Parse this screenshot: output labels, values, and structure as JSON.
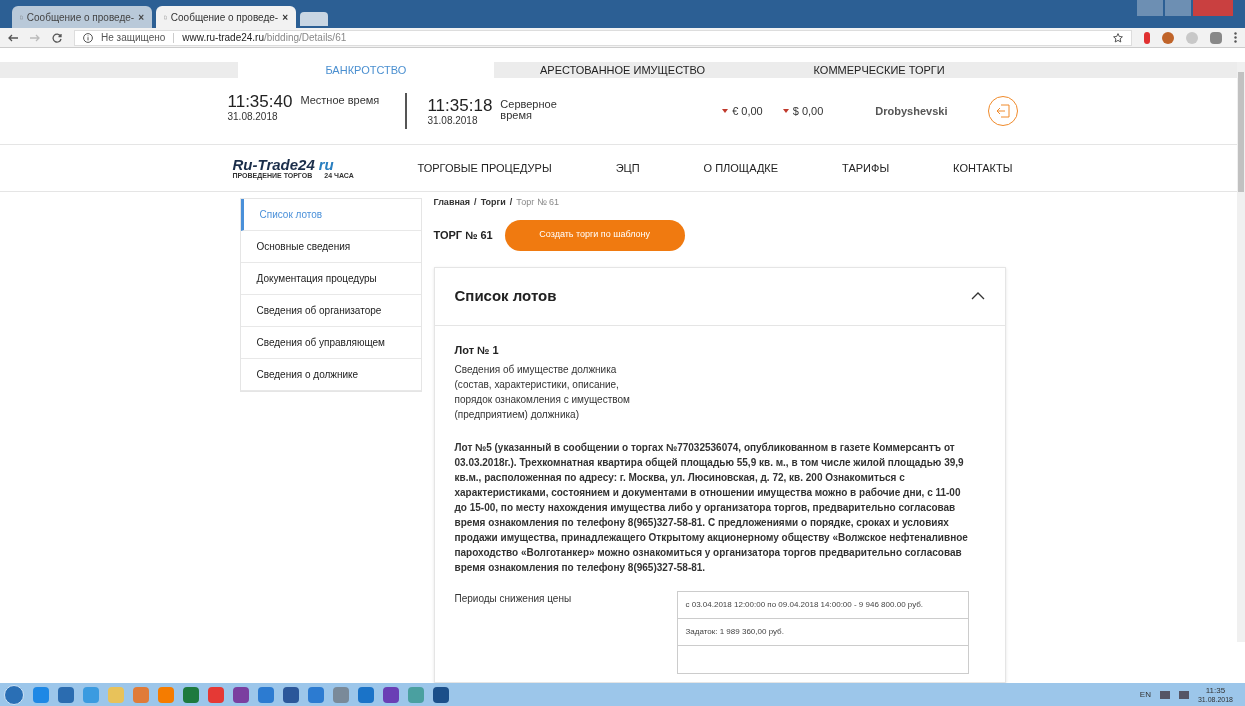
{
  "browser": {
    "tabs": [
      {
        "title": "Сообщение о проведе-",
        "close": "×",
        "selected": false
      },
      {
        "title": "Сообщение о проведе-",
        "close": "×",
        "selected": true
      }
    ],
    "security": "Не защищено",
    "url_host": "www.ru-trade24.ru",
    "url_path": "/bidding/Details/61"
  },
  "site_tabs": [
    {
      "label": "БАНКРОТСТВО",
      "selected": true
    },
    {
      "label": "АРЕСТОВАННОЕ ИМУЩЕСТВО",
      "selected": false
    },
    {
      "label": "КОММЕРЧЕСКИЕ ТОРГИ",
      "selected": false
    }
  ],
  "clocks": [
    {
      "time": "11:35:40",
      "date": "31.08.2018",
      "label": "Местное время"
    },
    {
      "time": "11:35:18",
      "date": "31.08.2018",
      "label": "Серверное время"
    }
  ],
  "balances": [
    "€ 0,00",
    "$ 0,00"
  ],
  "user": "Drobyshevski",
  "logo": {
    "main": "Ru-Trade24",
    "suffix": "ru",
    "tagline": "ПРОВЕДЕНИЕ ТОРГОВ",
    "hours": "24 ЧАСА"
  },
  "nav": [
    "ТОРГОВЫЕ ПРОЦЕДУРЫ",
    "ЭЦП",
    "О ПЛОЩАДКЕ",
    "ТАРИФЫ",
    "КОНТАКТЫ"
  ],
  "sidebar": [
    {
      "label": "Список лотов",
      "selected": true
    },
    {
      "label": "Основные сведения",
      "selected": false
    },
    {
      "label": "Документация процедуры",
      "selected": false
    },
    {
      "label": "Сведения об организаторе",
      "selected": false
    },
    {
      "label": "Сведения об управляющем",
      "selected": false
    },
    {
      "label": "Сведения о должнике",
      "selected": false
    }
  ],
  "breadcrumbs": [
    {
      "label": "Главная",
      "current": false
    },
    {
      "label": "Торги",
      "current": false
    },
    {
      "label": "Торг № 61",
      "current": true
    }
  ],
  "breadcrumb_separator": "/",
  "title": "ТОРГ № 61",
  "create_button": "Создать торги по шаблону",
  "panel": {
    "title": "Список лотов",
    "expanded": true,
    "lot_title": "Лот № 1",
    "property_label": "Сведения об имуществе должника (состав, характеристики, описание, порядок ознакомления с имуществом (предприятием) должника)",
    "property_text": "Лот №5 (указанный в сообщении о торгах №77032536074, опубликованном в газете Коммерсантъ от 03.03.2018г.). Трехкомнатная квартира общей площадью 55,9 кв. м., в том числе жилой площадью 39,9 кв.м., расположенная по адресу: г. Москва, ул. Люсиновская, д. 72, кв. 200 Ознакомиться с характеристиками, состоянием и документами в отношении имущества можно в рабочие дни, с 11-00 до 15-00, по месту нахождения имущества либо у организатора торгов, предварительно согласовав время ознакомления по телефону 8(965)327-58-81. С предложениями о порядке, сроках и условиях продажи имущества, принадлежащего Открытому акционерному обществу «Волжское нефтеналивное пароходство «Волготанкер» можно ознакомиться у организатора торгов предварительно согласовав время ознакомления по телефону 8(965)327-58-81.",
    "periods_label": "Периоды снижения цены",
    "periods": [
      "с 03.04.2018 12:00:00 по 09.04.2018 14:00:00 - 9 946 800.00 руб.",
      "Задаток: 1 989 360,00 руб."
    ]
  },
  "taskbar": {
    "language": "EN",
    "time": "11:35",
    "date": "31.08.2018"
  }
}
